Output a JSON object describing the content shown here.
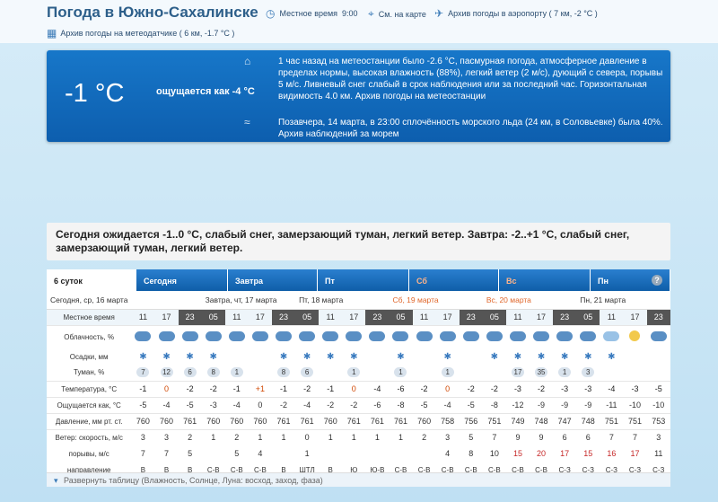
{
  "header": {
    "title": "Погода в Южно-Сахалинске",
    "local_time_label": "Местное время",
    "local_time": "9:00",
    "map_label": "См. на карте",
    "airport_archive": "Архив погоды в аэропорту ( 7 км, -2 °C )",
    "station_archive": "Архив погоды на метеодатчике ( 6 км, -1.7 °C )"
  },
  "now": {
    "temperature": "-1 °C",
    "feels_like": "ощущается как -4 °C",
    "station_text": "1 час назад на метеостанции было -2.6 °C, пасмурная погода, атмосферное давление в пределах нормы, высокая влажность (88%), легкий ветер (2 м/с), дующий с севера, порывы 5 м/с. Ливневый снег слабый в срок наблюдения или за последний час. Горизонтальная видимость 4.0 км. Архив погоды на метеостанции",
    "sea_text": "Позавчера, 14 марта, в 23:00 сплочённость морского льда (24 км, в Соловьевке) была 40%. Архив наблюдений за морем"
  },
  "forecast_summary": "Сегодня ожидается -1..0 °C, слабый снег, замерзающий туман, легкий ветер. Завтра: -2..+1 °C, слабый снег, замерзающий туман, легкий ветер.",
  "tabs": [
    {
      "label": "6 суток",
      "active": true,
      "weekend": false
    },
    {
      "label": "Сегодня",
      "active": false,
      "weekend": false
    },
    {
      "label": "Завтра",
      "active": false,
      "weekend": false
    },
    {
      "label": "Пт",
      "active": false,
      "weekend": false
    },
    {
      "label": "Сб",
      "active": false,
      "weekend": true
    },
    {
      "label": "Вс",
      "active": false,
      "weekend": true
    },
    {
      "label": "Пн",
      "active": false,
      "weekend": false
    }
  ],
  "days": [
    {
      "label": "Сегодня, ср, 16 марта",
      "cols": 3,
      "weekend": false
    },
    {
      "label": "Завтра, чт, 17 марта",
      "cols": 4,
      "weekend": false
    },
    {
      "label": "Пт, 18 марта",
      "cols": 4,
      "weekend": false
    },
    {
      "label": "Сб, 19 марта",
      "cols": 4,
      "weekend": true
    },
    {
      "label": "Вс, 20 марта",
      "cols": 4,
      "weekend": true
    },
    {
      "label": "Пн, 21 марта",
      "cols": 4,
      "weekend": false
    }
  ],
  "rows": {
    "local_time_label": "Местное время",
    "cloud_label": "Облачность, %",
    "precip_label": "Осадки, мм",
    "fog_label": "Туман, %",
    "temp_label": "Температура, °C",
    "feels_label": "Ощущается как, °C",
    "pressure_label": "Давление, мм рт. ст.",
    "wind_label": "Ветер: скорость, м/с",
    "gusts_label": "порывы, м/с",
    "dir_label": "направление"
  },
  "hours": [
    "11",
    "17",
    "23",
    "05",
    "11",
    "17",
    "23",
    "05",
    "11",
    "17",
    "23",
    "05",
    "11",
    "17",
    "23",
    "05",
    "11",
    "17",
    "23",
    "05",
    "11",
    "17",
    "23"
  ],
  "night": [
    false,
    false,
    true,
    true,
    false,
    false,
    true,
    true,
    false,
    false,
    true,
    true,
    false,
    false,
    true,
    true,
    false,
    false,
    true,
    true,
    false,
    false,
    true
  ],
  "cloud": [
    "ovc",
    "ovc",
    "ovc",
    "ovc",
    "ovc",
    "ovc",
    "ovc",
    "ovc",
    "ovc",
    "ovc",
    "ovc",
    "ovc",
    "ovc",
    "ovc",
    "ovc",
    "ovc",
    "ovc",
    "ovc",
    "ovc",
    "ovc",
    "sky",
    "sun",
    "ovc"
  ],
  "snow": [
    true,
    true,
    true,
    true,
    false,
    false,
    true,
    true,
    true,
    true,
    false,
    true,
    false,
    true,
    false,
    true,
    true,
    true,
    true,
    true,
    true,
    false,
    false
  ],
  "fog": [
    "7",
    "12",
    "6",
    "8",
    "1",
    "",
    "8",
    "6",
    "",
    "1",
    "",
    "1",
    "",
    "1",
    "",
    "",
    "17",
    "35",
    "1",
    "3",
    "",
    "",
    ""
  ],
  "temperature": [
    "-1",
    "0",
    "-2",
    "-2",
    "-1",
    "+1",
    "-1",
    "-2",
    "-1",
    "0",
    "-4",
    "-6",
    "-2",
    "0",
    "-2",
    "-2",
    "-3",
    "-2",
    "-3",
    "-3",
    "-4",
    "-3",
    "-5"
  ],
  "feels": [
    "-5",
    "-4",
    "-5",
    "-3",
    "-4",
    "0",
    "-2",
    "-4",
    "-2",
    "-2",
    "-6",
    "-8",
    "-5",
    "-4",
    "-5",
    "-8",
    "-12",
    "-9",
    "-9",
    "-9",
    "-11",
    "-10",
    "-10"
  ],
  "pressure": [
    "760",
    "760",
    "761",
    "760",
    "760",
    "760",
    "761",
    "761",
    "760",
    "761",
    "761",
    "761",
    "760",
    "758",
    "756",
    "751",
    "749",
    "748",
    "747",
    "748",
    "751",
    "751",
    "753"
  ],
  "wind": [
    "3",
    "3",
    "2",
    "1",
    "2",
    "1",
    "1",
    "0",
    "1",
    "1",
    "1",
    "1",
    "2",
    "3",
    "5",
    "7",
    "9",
    "9",
    "6",
    "6",
    "7",
    "7",
    "3"
  ],
  "gusts": [
    "7",
    "7",
    "5",
    "",
    "5",
    "4",
    "",
    "1",
    "",
    "",
    "",
    "",
    "",
    "4",
    "8",
    "10",
    "15",
    "20",
    "17",
    "15",
    "16",
    "17",
    "11"
  ],
  "direction": [
    "В",
    "В",
    "В",
    "С-В",
    "С-В",
    "С-В",
    "В",
    "ШТЛ",
    "В",
    "Ю",
    "Ю-В",
    "С-В",
    "С-В",
    "С-В",
    "С-В",
    "С-В",
    "С-В",
    "С-В",
    "С-З",
    "С-З",
    "С-З",
    "С-З",
    "С-З"
  ],
  "expand_label": "Развернуть таблицу (Влажность, Солнце, Луна: восход, заход, фаза)",
  "colors": {
    "accent": "#0d5eae",
    "weekend": "#e0662a",
    "warm": "#d04600"
  }
}
